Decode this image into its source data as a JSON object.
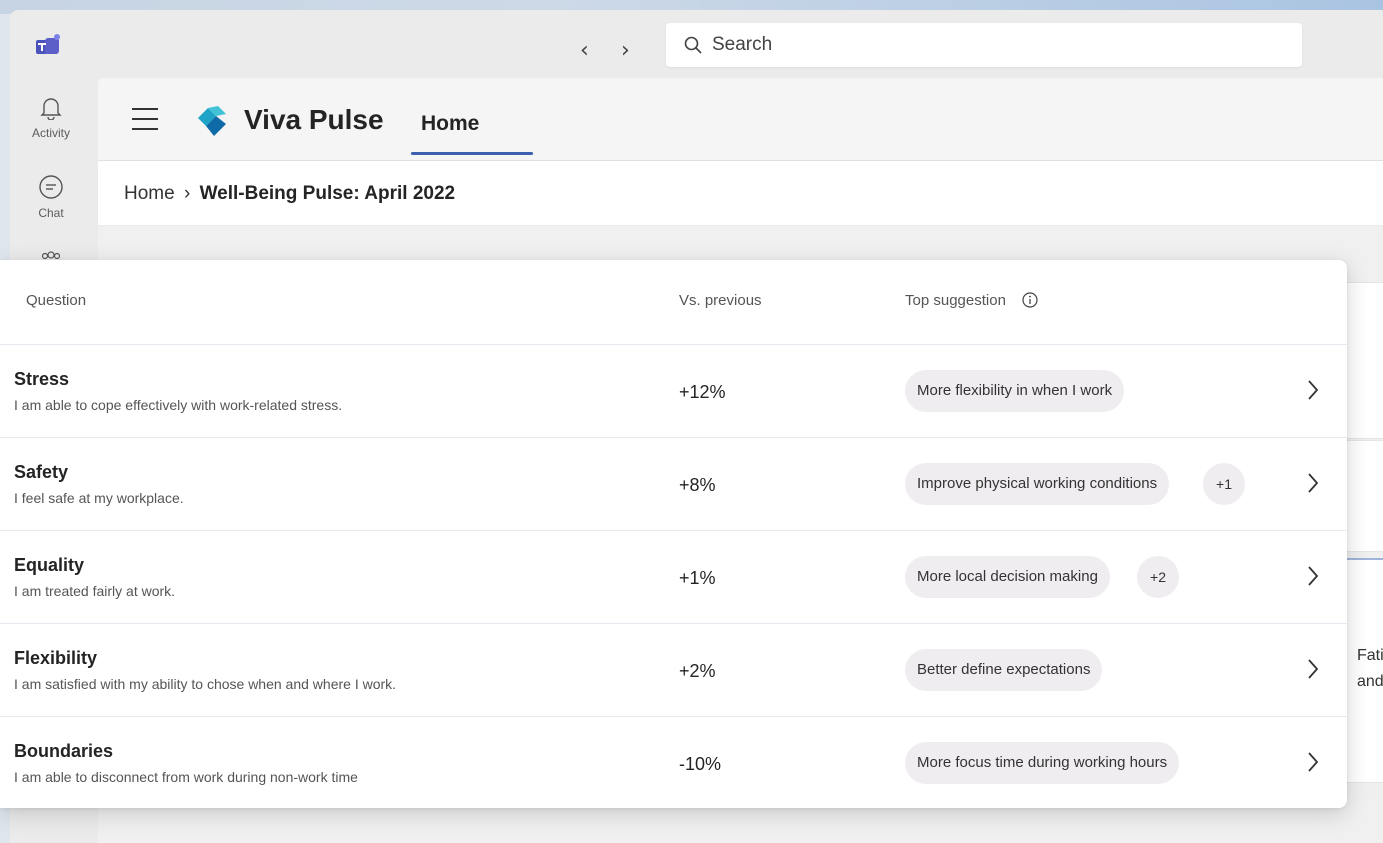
{
  "topbar": {
    "search_placeholder": "Search",
    "back_icon": "chevron-left-icon",
    "forward_icon": "chevron-right-icon"
  },
  "rail": {
    "items": [
      {
        "label": "Activity",
        "icon": "bell-icon"
      },
      {
        "label": "Chat",
        "icon": "chat-icon"
      }
    ]
  },
  "app": {
    "title": "Viva Pulse",
    "tabs": [
      {
        "label": "Home",
        "selected": true
      }
    ],
    "accent": "#3d5fad"
  },
  "breadcrumb": {
    "home": "Home",
    "separator": "›",
    "current": "Well-Being Pulse: April 2022"
  },
  "table": {
    "headers": {
      "question": "Question",
      "vs_previous": "Vs. previous",
      "top_suggestion": "Top suggestion"
    },
    "rows": [
      {
        "title": "Stress",
        "description": "I am able to cope effectively with work-related stress.",
        "change": "+12%",
        "suggestion": "More flexibility in when I work",
        "more": ""
      },
      {
        "title": "Safety",
        "description": "I feel safe at my workplace.",
        "change": "+8%",
        "suggestion": "Improve physical working conditions",
        "more": "+1"
      },
      {
        "title": "Equality",
        "description": "I am treated fairly at work.",
        "change": "+1%",
        "suggestion": "More local decision making",
        "more": "+2"
      },
      {
        "title": "Flexibility",
        "description": "I am satisfied with my ability to chose when and where I work.",
        "change": "+2%",
        "suggestion": "Better define expectations",
        "more": ""
      },
      {
        "title": "Boundaries",
        "description": "I am able to disconnect from work during non-work time",
        "change": "-10%",
        "suggestion": "More focus time during working hours",
        "more": ""
      }
    ]
  },
  "background_card": {
    "line1": "Fati",
    "line2": "and"
  }
}
